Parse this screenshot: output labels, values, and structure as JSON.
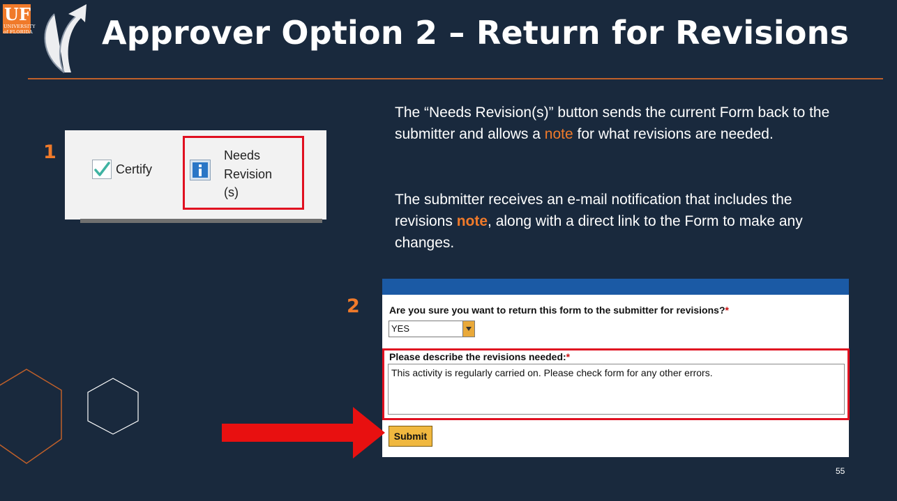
{
  "slide": {
    "title": "Approver Option 2 – Return for Revisions",
    "page_number": "55",
    "step1_number": "1",
    "step2_number": "2",
    "colors": {
      "background": "#19293d",
      "accent": "#f07a2a",
      "highlight_box": "#e01020"
    }
  },
  "logo": {
    "text": "UF",
    "subtext": "UNIVERSITY of FLORIDA"
  },
  "description": {
    "p1_part1": "The “Needs Revision(s)” button sends the current Form back to the submitter and allows a ",
    "p1_note": "note",
    "p1_part2": " for what revisions are needed.",
    "p2_part1": "The submitter receives an e-mail notification that includes the revisions ",
    "p2_note": "note",
    "p2_part2": ", along with a direct link to the Form to make any changes."
  },
  "toolbar": {
    "certify_label": "Certify",
    "needs_revision_line1": "Needs",
    "needs_revision_line2": "Revision",
    "needs_revision_line3": "(s)"
  },
  "form": {
    "question": "Are you sure you want to return this form to the submitter for revisions?",
    "required_marker": "*",
    "select_value": "YES",
    "describe_label": "Please describe the revisions needed:",
    "textarea_value": "This activity is regularly carried on.  Please check form for any other errors.",
    "submit_label": "Submit"
  }
}
